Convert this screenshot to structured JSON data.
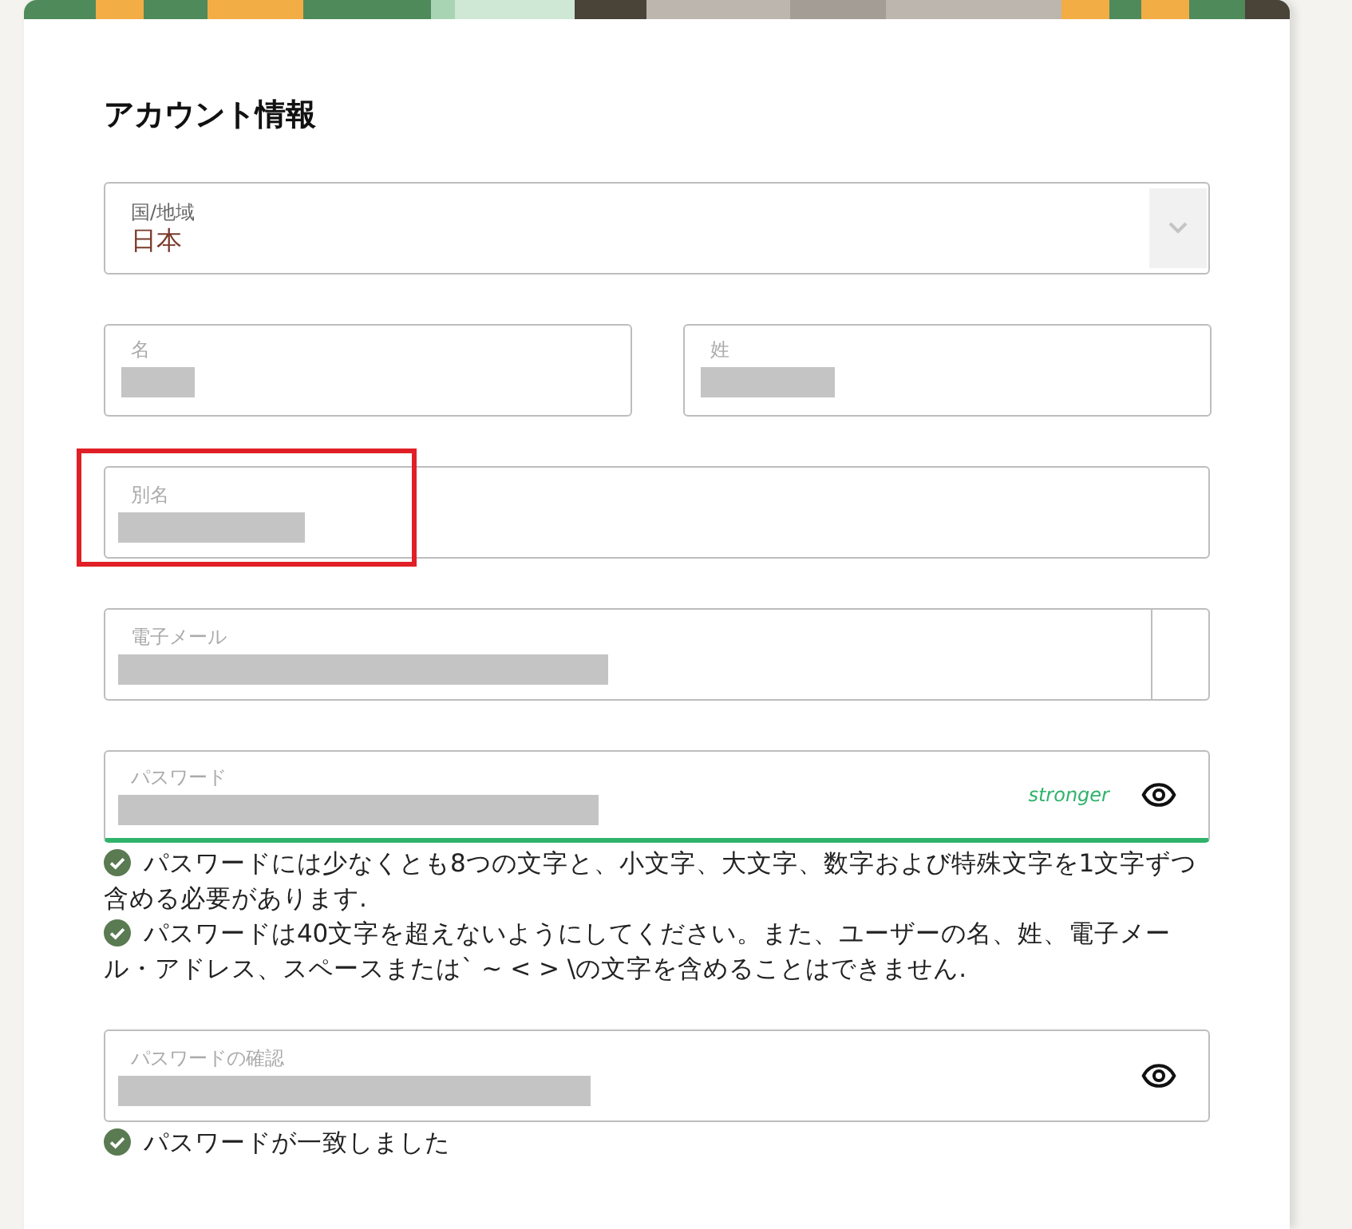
{
  "section_title": "アカウント情報",
  "fields": [
    {
      "kind": "select",
      "label": "国/地域",
      "value": "日本"
    },
    {
      "kind": "pair",
      "items": [
        {
          "label": "名",
          "redacted": true
        },
        {
          "label": "姓",
          "redacted": true
        }
      ]
    },
    {
      "kind": "text",
      "label": "別名",
      "redacted": true,
      "highlighted": true
    },
    {
      "kind": "email",
      "label": "電子メール",
      "redacted": true
    },
    {
      "kind": "password",
      "label": "パスワード",
      "redacted": true,
      "strength": "stronger",
      "reveal": true,
      "rules": [
        {
          "text": "パスワードには少なくとも8つの文字と、小文字、大文字、数字および特殊文字を1文字ずつ含める必要があります.",
          "met": true
        },
        {
          "text": "パスワードは40文字を超えないようにしてください。また、ユーザーの名、姓、電子メール・アドレス、スペースまたは` ~ < > \\の文字を含めることはできません.",
          "met": true
        }
      ]
    },
    {
      "kind": "password",
      "label": "パスワードの確認",
      "redacted": true,
      "reveal": true,
      "rules": [
        {
          "text": "パスワードが一致しました",
          "met": true
        }
      ]
    }
  ]
}
